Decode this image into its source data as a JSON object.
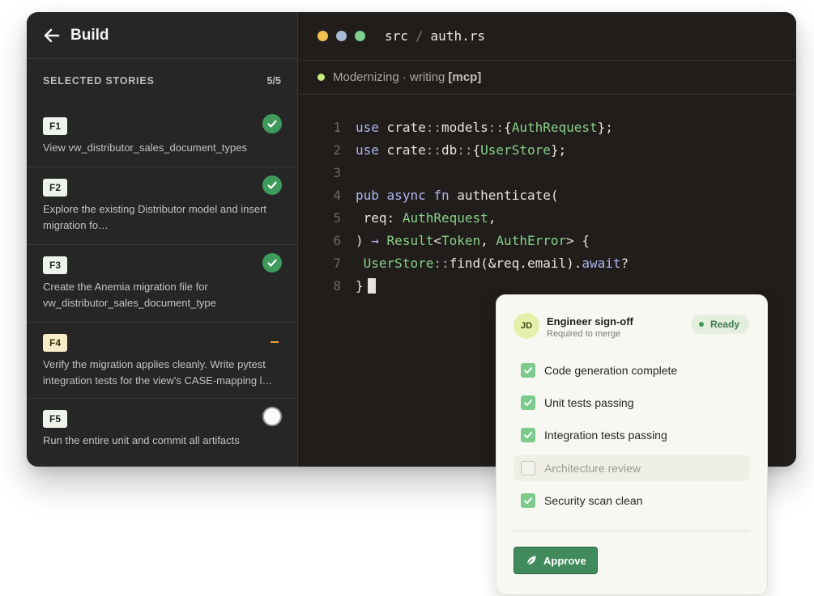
{
  "sidebar": {
    "title": "Build",
    "section_label": "SELECTED STORIES",
    "section_count": "5/5",
    "stories": [
      {
        "id": "F1",
        "description": "View vw_distributor_sales_document_types",
        "status": "done"
      },
      {
        "id": "F2",
        "description": "Explore the existing Distributor model and insert migration fo…",
        "status": "done"
      },
      {
        "id": "F3",
        "description": "Create the Anemia migration file for vw_distributor_sales_document_type",
        "status": "done"
      },
      {
        "id": "F4",
        "description": "Verify the migration applies cleanly. Write pytest integration tests for the view's CASE-mapping l…",
        "status": "in-progress"
      },
      {
        "id": "F5",
        "description": "Run the entire unit and commit all artifacts",
        "status": "pending"
      }
    ]
  },
  "editor": {
    "path_dir": "src",
    "path_sep": "/",
    "path_file": "auth.rs",
    "status_text": "Modernizing · writing",
    "status_tag": "[mcp]",
    "line_numbers": [
      "1",
      "2",
      "3",
      "4",
      "5",
      "6",
      "7",
      "8"
    ],
    "code": {
      "l1": {
        "kw": "use",
        "a": "crate",
        "b": "models",
        "ty": "AuthRequest"
      },
      "l2": {
        "kw": "use",
        "a": "crate",
        "b": "db",
        "ty": "UserStore"
      },
      "l4": {
        "kw1": "pub",
        "kw2": "async",
        "kw3": "fn",
        "name": "authenticate"
      },
      "l5": {
        "param": "req",
        "ty": "AuthRequest"
      },
      "l6": {
        "arrow": "→",
        "ty1": "Result",
        "ty2": "Token",
        "ty3": "AuthError"
      },
      "l7": {
        "ty": "UserStore",
        "call": "find(&req.email).",
        "kw": "await",
        "q": "?"
      },
      "l8": {
        "close": "}"
      }
    }
  },
  "signoff": {
    "avatar_initials": "JD",
    "title": "Engineer sign-off",
    "subtitle": "Required to merge",
    "status": "Ready",
    "checks": [
      {
        "label": "Code generation complete",
        "checked": true
      },
      {
        "label": "Unit tests passing",
        "checked": true
      },
      {
        "label": "Integration tests passing",
        "checked": true
      },
      {
        "label": "Architecture review",
        "checked": false
      },
      {
        "label": "Security scan clean",
        "checked": true
      }
    ],
    "approve_label": "Approve"
  },
  "colors": {
    "sidebar_bg": "#262626",
    "editor_bg": "#201d1b",
    "accent_green": "#418a5c",
    "keyword": "#aeb6f0",
    "type": "#89d089"
  },
  "icons": {
    "back": "arrow-left-icon",
    "done": "check-circle-icon",
    "pending": "empty-circle-icon",
    "approve": "leaf-icon"
  }
}
